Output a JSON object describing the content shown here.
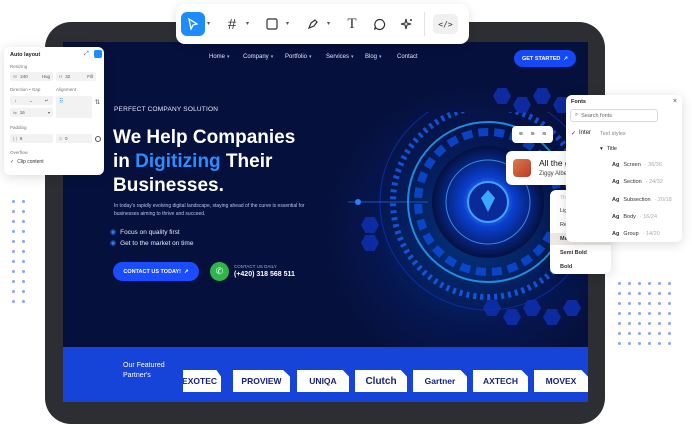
{
  "toolbar": {
    "tools": [
      {
        "name": "move",
        "icon": "cursor-icon"
      },
      {
        "name": "frame",
        "icon": "hash-frame-icon"
      },
      {
        "name": "shape",
        "icon": "rectangle-icon"
      },
      {
        "name": "pen",
        "icon": "pen-icon"
      },
      {
        "name": "text",
        "icon": "text-icon",
        "glyph": "T"
      },
      {
        "name": "comment",
        "icon": "comment-icon"
      },
      {
        "name": "ai",
        "icon": "sparkle-icon"
      }
    ],
    "code_label": "</>"
  },
  "auto_layout": {
    "title": "Auto layout",
    "resizing_label": "Resizing",
    "w_prefix": "W",
    "w_value": "240",
    "w_mode": "Hug",
    "h_prefix": "H",
    "h_value": "32",
    "h_mode": "Fill",
    "direction_label": "Direction • Gap",
    "alignment_label": "Alignment",
    "gap_value": "16",
    "padding_label": "Padding",
    "pad_h": "8",
    "pad_v": "0",
    "overflow_label": "Overflow",
    "clip_label": "Clip content"
  },
  "website": {
    "nav": {
      "items": [
        "Home",
        "Company",
        "Portfolio",
        "Services",
        "Blog",
        "Contact"
      ],
      "cta": "GET STARTED"
    },
    "eyebrow": "PERFECT COMPANY SOLUTION",
    "headline": {
      "line1": "We Help Companies",
      "line2_pre": "in ",
      "line2_highlight": "Digitizing",
      "line2_post": " Their",
      "line3": "Businesses."
    },
    "description": "In today's rapidly evolving digital landscape, staying ahead of the curve is essential for businesses aiming to thrive and succeed.",
    "checks": [
      "Focus on quality first",
      "Get to the market on time"
    ],
    "contact_button": "CONTACT US TODAY!",
    "contact_label": "CONTACT US DAILY",
    "contact_phone": "(+420) 318 568 511",
    "partners_title": "Our Featured Partner's",
    "partners": [
      "EXOTEC",
      "PROVIEW",
      "UNIQA",
      "Clutch",
      "Gartner",
      "AXTECH",
      "MOVEX"
    ]
  },
  "fonts_panel": {
    "title": "Fonts",
    "close": "×",
    "search_placeholder": "Search fonts",
    "current_font": "Inter",
    "section": "Text styles",
    "group": "Title",
    "styles": [
      {
        "ag": "Ag",
        "name": "Screen",
        "meta": "· 36/36"
      },
      {
        "ag": "Ag",
        "name": "Section",
        "meta": "· 24/32"
      },
      {
        "ag": "Ag",
        "name": "Subsection",
        "meta": "· 20/18"
      },
      {
        "ag": "Ag",
        "name": "Body",
        "meta": "· 16/24"
      },
      {
        "ag": "Ag",
        "name": "Group",
        "meta": "· 14/20"
      }
    ]
  },
  "weights": {
    "header": "Thin",
    "items": [
      "Light",
      "Regular",
      "Medium",
      "Semi Bold",
      "Bold"
    ],
    "selected": "Medium"
  },
  "profile_card": {
    "title": "All the good things",
    "name": "Ziggy Alberts"
  },
  "colors": {
    "accent": "#1d8cff",
    "site_bg": "#06103c",
    "site_blue": "#1643d8",
    "highlight": "#2f8cff",
    "green": "#2fb64b"
  }
}
